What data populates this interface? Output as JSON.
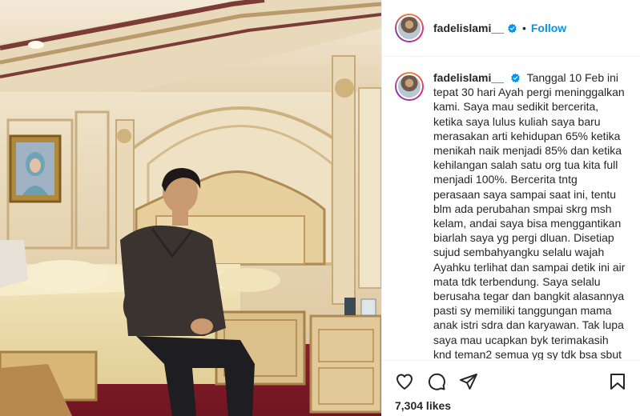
{
  "post": {
    "username": "fadelislami__",
    "verified": true,
    "separator": "•",
    "follow_label": "Follow",
    "caption_username": "fadelislami__",
    "caption_text": "Tanggal 10 Feb ini tepat 30 hari Ayah pergi meninggalkan kami. Saya mau sedikit bercerita, ketika saya lulus kuliah saya baru merasakan arti kehidupan 65% ketika menikah naik menjadi 85% dan ketika kehilangan salah satu org tua kita full menjadi 100%. Bercerita tntg perasaan saya sampai saat ini, tentu blm ada perubahan smpai skrg msh kelam, andai saya bisa menggantikan biarlah saya yg pergi dluan. Disetiap sujud sembahyangku selalu wajah Ayahku terlihat dan sampai detik ini air mata tdk terbendung. Saya selalu berusaha tegar dan bangkit alasannya pasti sy memiliki tanggungan mama anak istri sdra dan karyawan. Tak lupa saya mau ucapkan byk terimakasih knd teman2 semua yg sy tdk bsa sbut",
    "likes": "7,304 likes"
  },
  "icons": {
    "like": "heart-icon",
    "comment": "comment-icon",
    "share": "share-icon",
    "save": "bookmark-icon",
    "verified": "verified-badge-icon"
  },
  "colors": {
    "accent": "#0095f6",
    "text": "#262626",
    "divider": "#efefef"
  }
}
